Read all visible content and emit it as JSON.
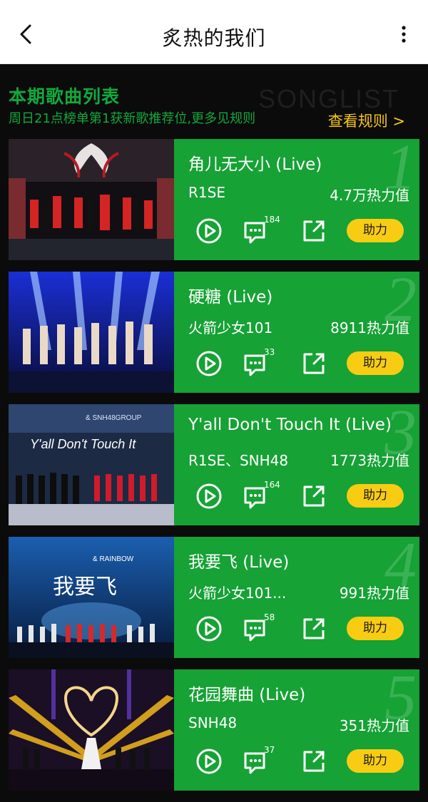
{
  "header": {
    "title": "炙热的我们"
  },
  "section": {
    "title": "本期歌曲列表",
    "subtitle": "周日21点榜单第1获新歌推荐位,更多见规则",
    "bg_text": "SONGLIST",
    "rules_label": "查看规则 >"
  },
  "colors": {
    "panel_green": "#16a235",
    "accent_yellow": "#f8cc13",
    "heading_green": "#12a83b",
    "link_yellow": "#f5c518"
  },
  "songs": [
    {
      "rank": "1",
      "title": "角儿无大小 (Live)",
      "artist": "R1SE",
      "heat": "4.7万热力值",
      "comments": "184",
      "boost_label": "助力"
    },
    {
      "rank": "2",
      "title": "硬糖 (Live)",
      "artist": "火箭少女101",
      "heat": "8911热力值",
      "comments": "33",
      "boost_label": "助力"
    },
    {
      "rank": "3",
      "title": "Y'all Don't Touch It (Live)",
      "artist": "R1SE、SNH48",
      "heat": "1773热力值",
      "comments": "164",
      "boost_label": "助力"
    },
    {
      "rank": "4",
      "title": "我要飞 (Live)",
      "artist": "火箭少女101...",
      "heat": "991热力值",
      "comments": "58",
      "boost_label": "助力"
    },
    {
      "rank": "5",
      "title": "花园舞曲 (Live)",
      "artist": "SNH48",
      "heat": "351热力值",
      "comments": "37",
      "boost_label": "助力"
    }
  ],
  "thumbs": [
    {
      "overlay": "",
      "subtext": ""
    },
    {
      "overlay": "",
      "subtext": ""
    },
    {
      "overlay": "Y'all Don't Touch It",
      "subtext": "& SNH48GROUP"
    },
    {
      "overlay": "我要飞",
      "subtext": "& RAINBOW"
    },
    {
      "overlay": "",
      "subtext": ""
    }
  ]
}
